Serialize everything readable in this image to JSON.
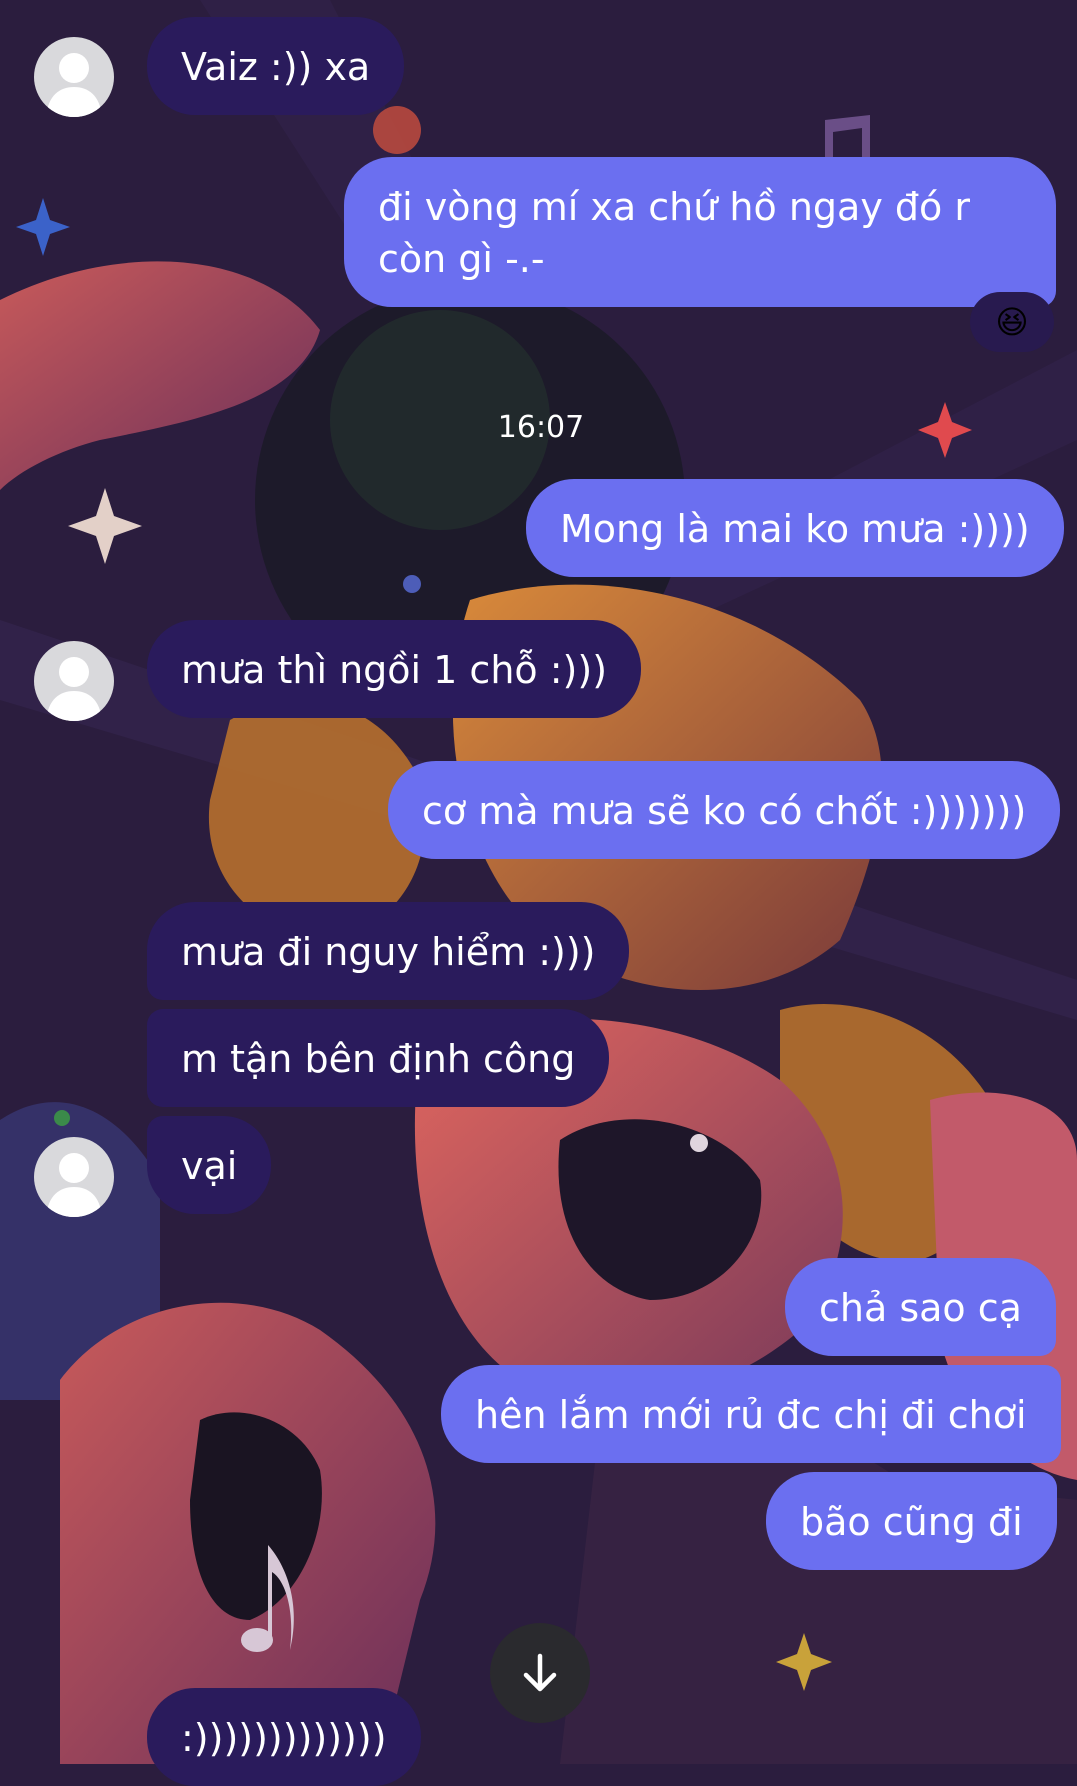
{
  "colors": {
    "incoming_bubble": "#2a1b5c",
    "outgoing_bubble": "#6b6ff0",
    "background": "#2b1d3e",
    "text": "#ffffff"
  },
  "messages": [
    {
      "direction": "incoming",
      "text": "Vaiz :)) xa"
    },
    {
      "direction": "outgoing",
      "text": "đi vòng mí xa chứ hồ ngay đó r còn gì -.-",
      "reaction": "grinning-squinting-face"
    },
    {
      "direction": "outgoing",
      "text": "Mong là mai ko mưa :))))"
    },
    {
      "direction": "incoming",
      "text": "mưa thì ngồi 1 chỗ :)))"
    },
    {
      "direction": "outgoing",
      "text": "cơ mà mưa sẽ ko có chốt :)))))))"
    },
    {
      "direction": "incoming",
      "text": "mưa đi nguy hiểm :)))"
    },
    {
      "direction": "incoming",
      "text": "m tận bên định công"
    },
    {
      "direction": "incoming",
      "text": "vại"
    },
    {
      "direction": "outgoing",
      "text": "chả sao cạ"
    },
    {
      "direction": "outgoing",
      "text": "hên lắm mới rủ đc chị đi chơi"
    },
    {
      "direction": "outgoing",
      "text": "bão cũng đi"
    },
    {
      "direction": "incoming",
      "text": ":)))))))))))))"
    }
  ],
  "timestamps": [
    "16:07"
  ],
  "reaction_emoji": "😆",
  "scroll_button": {
    "icon": "arrow-down-icon"
  }
}
